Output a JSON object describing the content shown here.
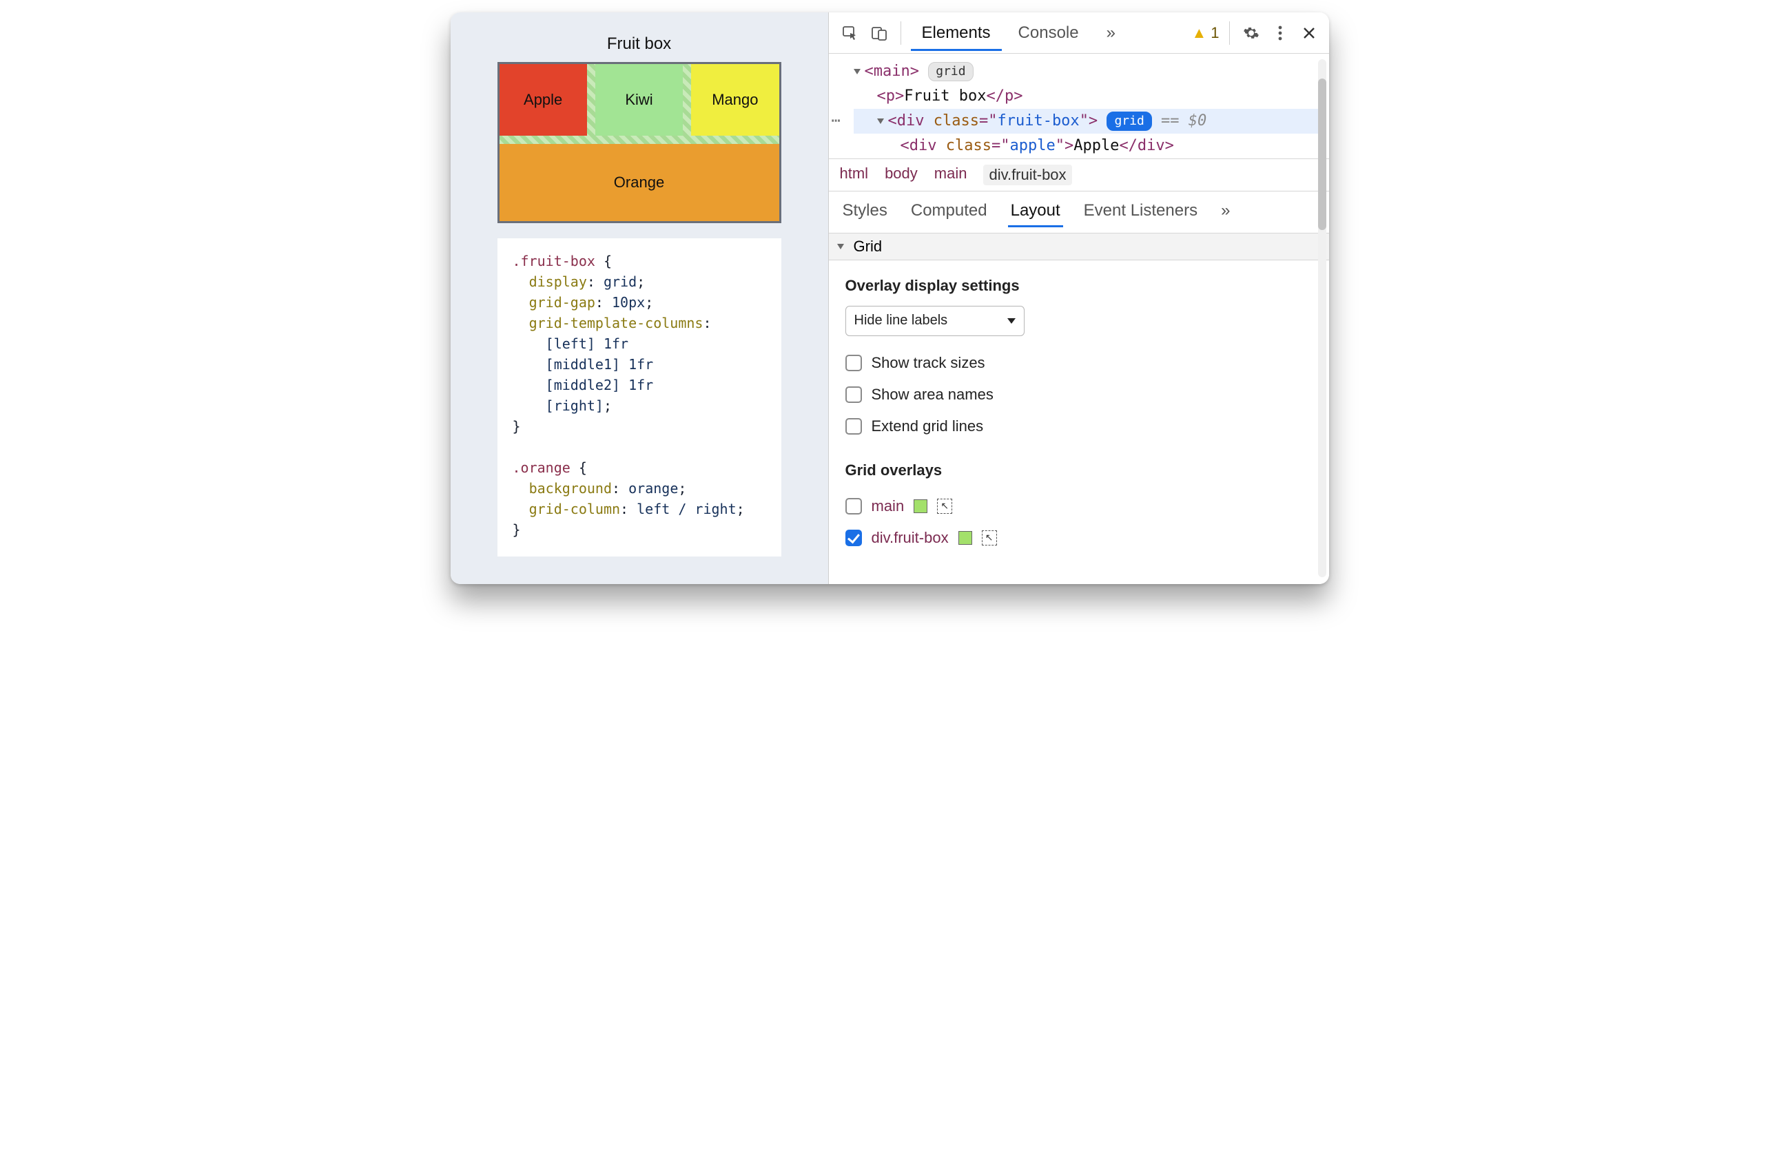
{
  "page": {
    "title": "Fruit box",
    "cells": {
      "apple": "Apple",
      "kiwi": "Kiwi",
      "mango": "Mango",
      "orange": "Orange"
    },
    "css": ".fruit-box {\n  display: grid;\n  grid-gap: 10px;\n  grid-template-columns:\n    [left] 1fr\n    [middle1] 1fr\n    [middle2] 1fr\n    [right];\n}\n\n.orange {\n  background: orange;\n  grid-column: left / right;\n}"
  },
  "devtools": {
    "tabs": {
      "elements": "Elements",
      "console": "Console"
    },
    "overflow": "»",
    "warning_count": "1",
    "dom": {
      "main_tag": "main",
      "grid_pill": "grid",
      "p_text": "Fruit box",
      "div_class": "fruit-box",
      "selected_suffix": "== $0",
      "child_class": "apple",
      "child_text": "Apple"
    },
    "breadcrumbs": [
      "html",
      "body",
      "main",
      "div.fruit-box"
    ],
    "subtabs": {
      "styles": "Styles",
      "computed": "Computed",
      "layout": "Layout",
      "listeners": "Event Listeners"
    },
    "section": "Grid",
    "overlay_settings": {
      "title": "Overlay display settings",
      "select_value": "Hide line labels",
      "show_track_sizes": "Show track sizes",
      "show_area_names": "Show area names",
      "extend_grid_lines": "Extend grid lines"
    },
    "grid_overlays": {
      "title": "Grid overlays",
      "items": [
        {
          "label": "main",
          "checked": false
        },
        {
          "label": "div.fruit-box",
          "checked": true
        }
      ]
    }
  }
}
